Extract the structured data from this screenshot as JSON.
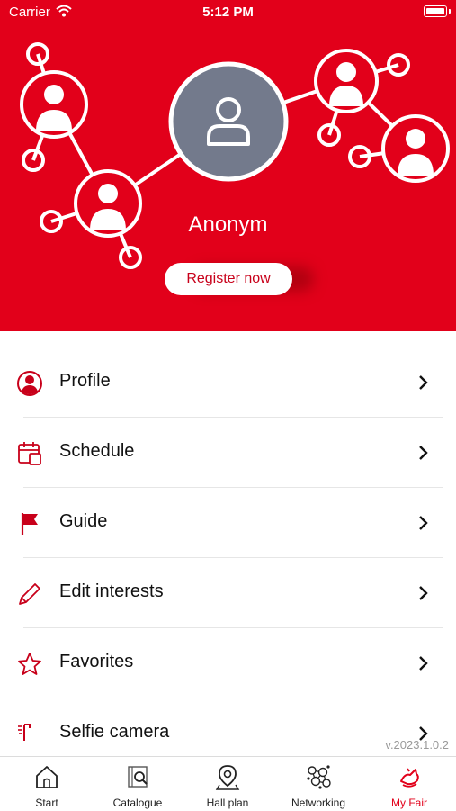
{
  "status_bar": {
    "carrier": "Carrier",
    "time": "5:12 PM"
  },
  "profile": {
    "name": "Anonym",
    "register_label": "Register now"
  },
  "menu": {
    "items": [
      {
        "label": "Profile",
        "icon": "person-circle-icon"
      },
      {
        "label": "Schedule",
        "icon": "calendar-icon"
      },
      {
        "label": "Guide",
        "icon": "flag-icon"
      },
      {
        "label": "Edit interests",
        "icon": "pencil-icon"
      },
      {
        "label": "Favorites",
        "icon": "star-icon"
      },
      {
        "label": "Selfie camera",
        "icon": "selfie-camera-icon"
      }
    ]
  },
  "version": "v.2023.1.0.2",
  "tabbar": {
    "tabs": [
      {
        "label": "Start",
        "icon": "home-icon"
      },
      {
        "label": "Catalogue",
        "icon": "catalogue-icon"
      },
      {
        "label": "Hall plan",
        "icon": "map-pin-icon"
      },
      {
        "label": "Networking",
        "icon": "network-icon"
      },
      {
        "label": "My Fair",
        "icon": "my-fair-icon"
      }
    ],
    "active": "My Fair"
  },
  "colors": {
    "brand": "#e2001a",
    "avatar": "#737a8c",
    "text": "#111111",
    "muted": "#9a9a9a"
  }
}
